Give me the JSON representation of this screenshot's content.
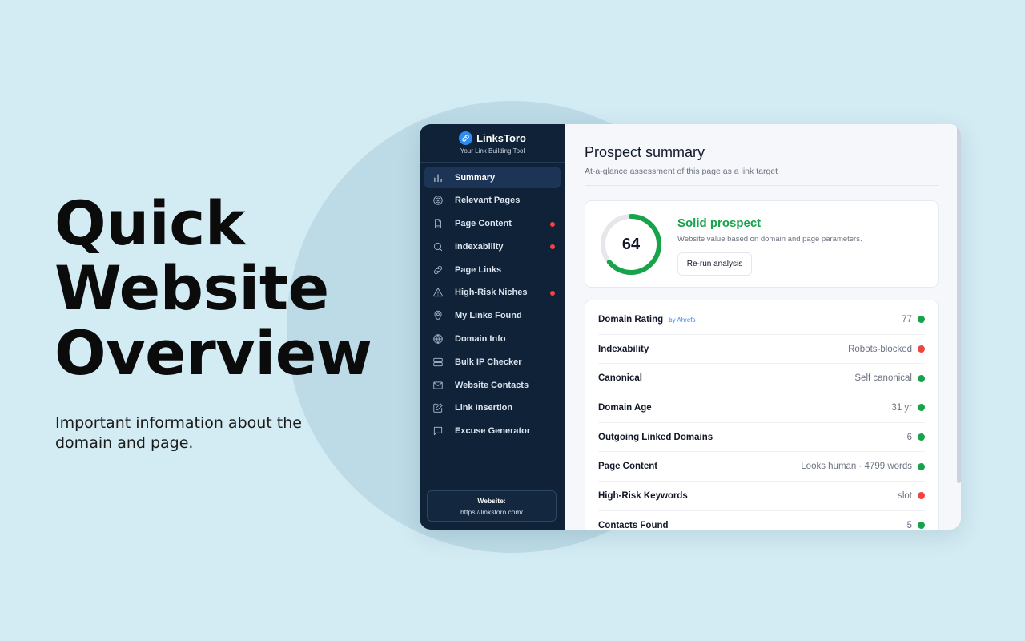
{
  "hero": {
    "title_lines": [
      "Quick",
      "Website",
      "Overview"
    ],
    "subtitle": "Important information about the domain and page."
  },
  "brand": {
    "name": "LinksToro",
    "tagline": "Your Link Building Tool",
    "logo_icon": "link-icon"
  },
  "sidebar": {
    "items": [
      {
        "label": "Summary",
        "icon": "bar-chart-icon",
        "active": true,
        "alert": false
      },
      {
        "label": "Relevant Pages",
        "icon": "target-icon",
        "active": false,
        "alert": false
      },
      {
        "label": "Page Content",
        "icon": "file-icon",
        "active": false,
        "alert": true
      },
      {
        "label": "Indexability",
        "icon": "search-icon",
        "active": false,
        "alert": true
      },
      {
        "label": "Page Links",
        "icon": "link-icon",
        "active": false,
        "alert": false
      },
      {
        "label": "High-Risk Niches",
        "icon": "warning-icon",
        "active": false,
        "alert": true
      },
      {
        "label": "My Links Found",
        "icon": "map-pin-icon",
        "active": false,
        "alert": false
      },
      {
        "label": "Domain Info",
        "icon": "globe-icon",
        "active": false,
        "alert": false
      },
      {
        "label": "Bulk IP Checker",
        "icon": "server-icon",
        "active": false,
        "alert": false
      },
      {
        "label": "Website Contacts",
        "icon": "mail-icon",
        "active": false,
        "alert": false
      },
      {
        "label": "Link Insertion",
        "icon": "edit-icon",
        "active": false,
        "alert": false
      },
      {
        "label": "Excuse Generator",
        "icon": "message-icon",
        "active": false,
        "alert": false
      }
    ],
    "website_label": "Website:",
    "website_url": "https://linkstoro.com/"
  },
  "main": {
    "title": "Prospect summary",
    "subtitle": "At-a-glance assessment of this page as a link target",
    "score": {
      "value": "64",
      "fraction": 0.64,
      "verdict": "Solid prospect",
      "description": "Website value based on domain and page parameters.",
      "rerun_label": "Re-run analysis"
    },
    "metrics": [
      {
        "label": "Domain Rating",
        "source": "by Ahrefs",
        "value": "77",
        "status": "green"
      },
      {
        "label": "Indexability",
        "source": "",
        "value": "Robots-blocked",
        "status": "red"
      },
      {
        "label": "Canonical",
        "source": "",
        "value": "Self canonical",
        "status": "green"
      },
      {
        "label": "Domain Age",
        "source": "",
        "value": "31 yr",
        "status": "green"
      },
      {
        "label": "Outgoing Linked Domains",
        "source": "",
        "value": "6",
        "status": "green"
      },
      {
        "label": "Page Content",
        "source": "",
        "value": "Looks human · 4799 words",
        "status": "green"
      },
      {
        "label": "High-Risk Keywords",
        "source": "",
        "value": "slot",
        "status": "red"
      },
      {
        "label": "Contacts Found",
        "source": "",
        "value": "5",
        "status": "green"
      }
    ]
  },
  "colors": {
    "background": "#d3ebf3",
    "sidebar": "#0f2238",
    "accent_green": "#16a34a",
    "alert_red": "#ef4444",
    "link_blue": "#3b82f6"
  }
}
